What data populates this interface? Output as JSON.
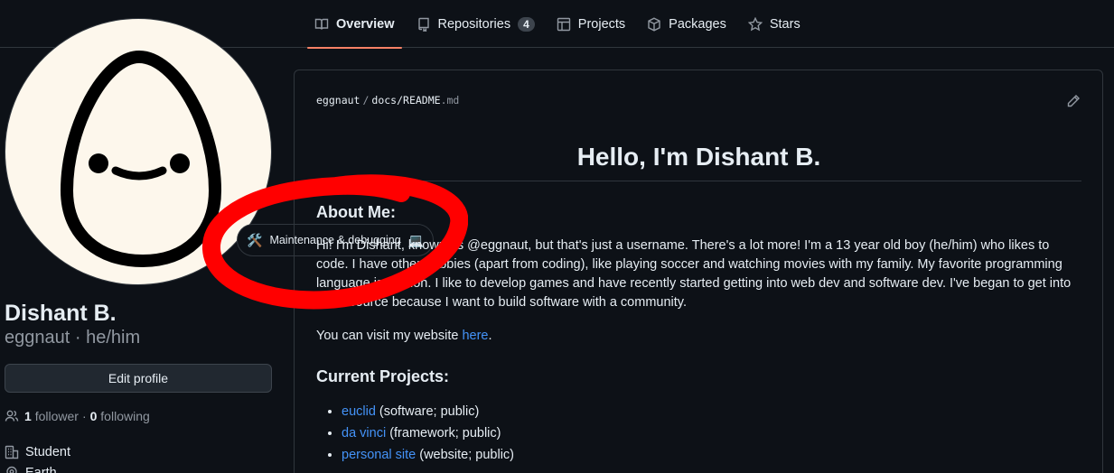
{
  "tabs": [
    {
      "label": "Overview",
      "icon": "book-icon",
      "active": true
    },
    {
      "label": "Repositories",
      "icon": "repo-icon",
      "count": "4"
    },
    {
      "label": "Projects",
      "icon": "table-icon"
    },
    {
      "label": "Packages",
      "icon": "package-icon"
    },
    {
      "label": "Stars",
      "icon": "star-icon"
    }
  ],
  "profile": {
    "status_emoji": "🛠️",
    "status_text": "Maintenance & debugging",
    "status_emoji2": "💻",
    "name": "Dishant B.",
    "login_line": "eggnaut · he/him",
    "edit_label": "Edit profile",
    "followers_count": "1",
    "followers_label": "follower",
    "dot": "·",
    "following_count": "0",
    "following_label": "following",
    "org": "Student",
    "location": "Earth"
  },
  "readme": {
    "path_owner": "eggnaut",
    "path_sep": "/",
    "path_file": "docs/README",
    "path_ext": ".md",
    "title": "Hello, I'm Dishant B.",
    "about_heading": "About Me:",
    "about_text": "Hi! I'm Dishant, known as @eggnaut, but that's just a username. There's a lot more! I'm a 13 year old boy (he/him) who likes to code. I have other hobbies (apart from coding), like playing soccer and watching movies with my family. My favorite programming language is Python. I like to develop games and have recently started getting into web dev and software dev. I've began to get into open source because I want to build software with a community.",
    "visit_prefix": "You can visit my website ",
    "visit_link": "here",
    "visit_suffix": ".",
    "projects_heading": "Current Projects:",
    "projects": [
      {
        "name": "euclid",
        "desc": " (software; public)"
      },
      {
        "name": "da vinci",
        "desc": " (framework; public)"
      },
      {
        "name": "personal site",
        "desc": " (website; public)"
      }
    ]
  },
  "colors": {
    "background": "#0d1117",
    "border": "#30363d",
    "link": "#4493f8",
    "tab_underline": "#f78166",
    "annotation": "#ff0000"
  }
}
